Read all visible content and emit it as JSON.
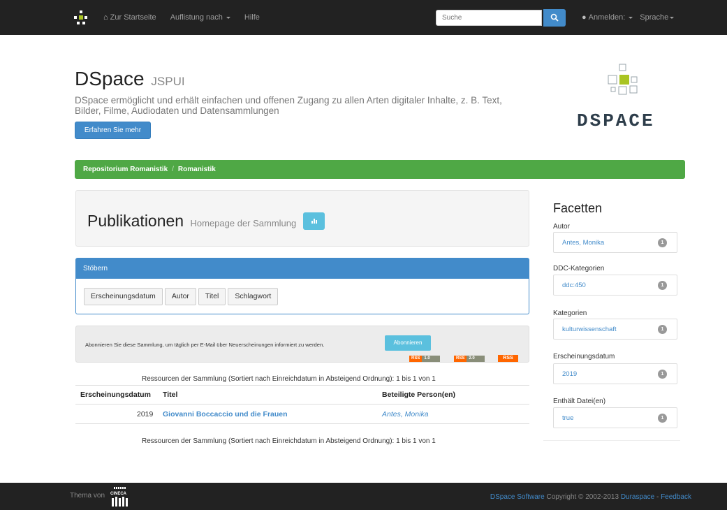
{
  "navbar": {
    "home": "Zur Startseite",
    "browse": "Auflistung nach",
    "help": "Hilfe",
    "search_placeholder": "Suche",
    "login": "Anmelden:",
    "language": "Sprache"
  },
  "header": {
    "title": "DSpace",
    "subtitle": "JSPUI",
    "lead": "DSpace ermöglicht und erhält einfachen und offenen Zugang zu allen Arten digitaler Inhalte, z. B. Text, Bilder, Filme, Audiodaten und Datensammlungen",
    "learn_more": "Erfahren Sie mehr",
    "logo_text": "DSPACE"
  },
  "breadcrumb": [
    "Repositorium Romanistik",
    "Romanistik"
  ],
  "collection": {
    "title": "Publikationen",
    "subtitle": "Homepage der Sammlung"
  },
  "browse": {
    "heading": "Stöbern",
    "buttons": [
      "Erscheinungsdatum",
      "Autor",
      "Titel",
      "Schlagwort"
    ]
  },
  "subscribe": {
    "text": "Abonnieren Sie diese Sammlung, um täglich per E-Mail über Neuerscheinungen informiert zu werden.",
    "button": "Abonnieren",
    "feeds": [
      {
        "a": "RSS",
        "b": "1.0"
      },
      {
        "a": "RSS",
        "b": "2.0"
      }
    ],
    "rss": "RSS"
  },
  "results": {
    "summary_top": "Ressourcen der Sammlung (Sortiert nach Einreichdatum in Absteigend Ordnung): 1 bis 1 von 1",
    "summary_bottom": "Ressourcen der Sammlung (Sortiert nach Einreichdatum in Absteigend Ordnung): 1 bis 1 von 1",
    "columns": [
      "Erscheinungsdatum",
      "Titel",
      "Beteiligte Person(en)"
    ],
    "rows": [
      {
        "year": "2019",
        "title": "Giovanni Boccaccio und die Frauen",
        "author": "Antes, Monika"
      }
    ]
  },
  "facets": {
    "title": "Facetten",
    "groups": [
      {
        "label": "Autor",
        "value": "Antes, Monika",
        "count": "1"
      },
      {
        "label": "DDC-Kategorien",
        "value": "ddc:450",
        "count": "1"
      },
      {
        "label": "Kategorien",
        "value": "kulturwissenschaft",
        "count": "1"
      },
      {
        "label": "Erscheinungsdatum",
        "value": "2019",
        "count": "1"
      },
      {
        "label": "Enthält Datei(en)",
        "value": "true",
        "count": "1"
      }
    ]
  },
  "footer": {
    "theme_by": "Thema von",
    "cineca_logo_text": "CINECA",
    "dspace_software": "DSpace Software",
    "copyright": "Copyright © 2002-2013",
    "duraspace": "Duraspace",
    "dash": "-",
    "feedback": "Feedback"
  }
}
